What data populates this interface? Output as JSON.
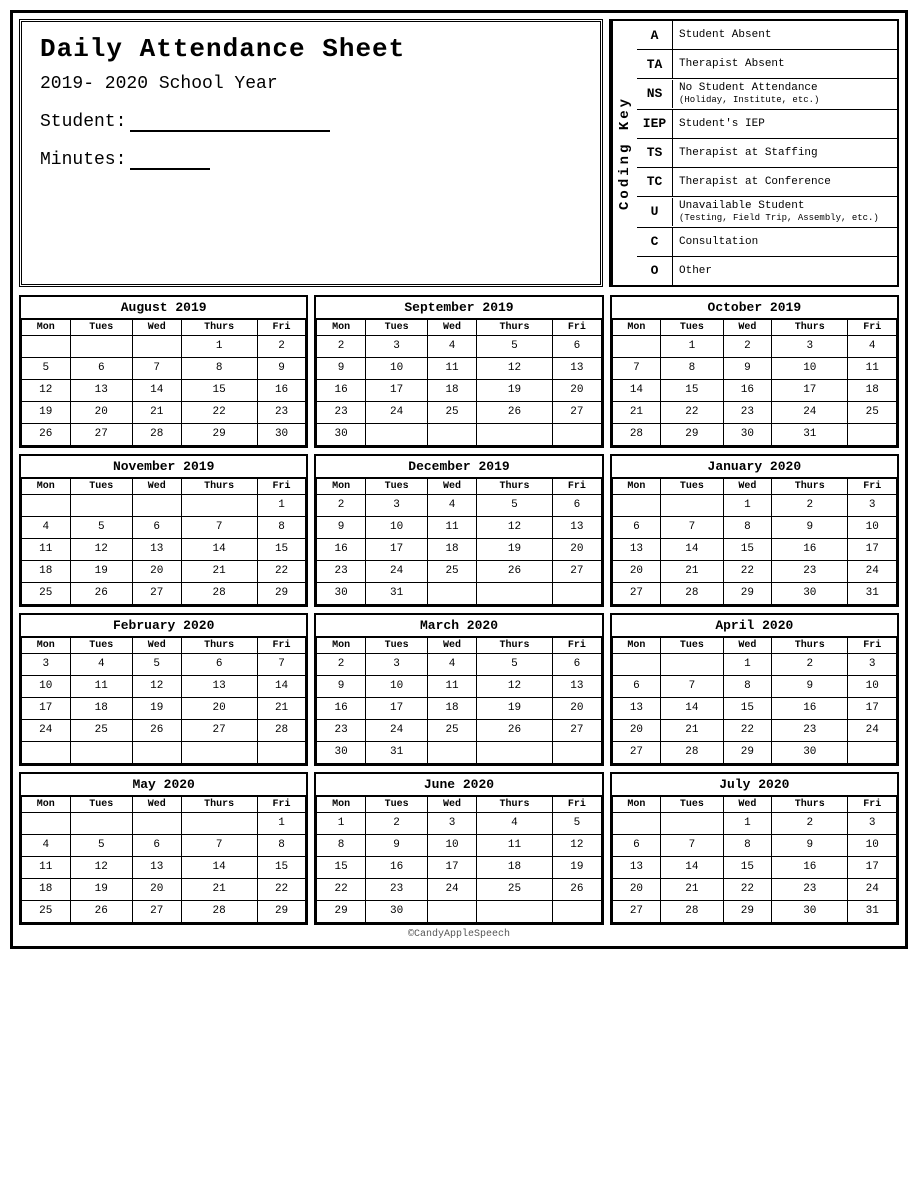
{
  "header": {
    "title": "Daily Attendance Sheet",
    "year": "2019- 2020 School Year",
    "student_label": "Student:",
    "minutes_label": "Minutes:"
  },
  "coding_key": {
    "label": "Coding Key",
    "items": [
      {
        "code": "A",
        "desc": "Student Absent",
        "sub": ""
      },
      {
        "code": "TA",
        "desc": "Therapist Absent",
        "sub": ""
      },
      {
        "code": "NS",
        "desc": "No Student Attendance",
        "sub": "(Holiday, Institute, etc.)"
      },
      {
        "code": "IEP",
        "desc": "Student's IEP",
        "sub": ""
      },
      {
        "code": "TS",
        "desc": "Therapist at Staffing",
        "sub": ""
      },
      {
        "code": "TC",
        "desc": "Therapist at Conference",
        "sub": ""
      },
      {
        "code": "U",
        "desc": "Unavailable Student",
        "sub": "(Testing, Field Trip, Assembly, etc.)"
      },
      {
        "code": "C",
        "desc": "Consultation",
        "sub": ""
      },
      {
        "code": "O",
        "desc": "Other",
        "sub": ""
      }
    ]
  },
  "calendars": [
    {
      "month": "August 2019",
      "days": [
        [
          "",
          "",
          "",
          "1",
          "2"
        ],
        [
          "5",
          "6",
          "7",
          "8",
          "9"
        ],
        [
          "12",
          "13",
          "14",
          "15",
          "16"
        ],
        [
          "19",
          "20",
          "21",
          "22",
          "23"
        ],
        [
          "26",
          "27",
          "28",
          "29",
          "30"
        ]
      ]
    },
    {
      "month": "September 2019",
      "days": [
        [
          "2",
          "3",
          "4",
          "5",
          "6"
        ],
        [
          "9",
          "10",
          "11",
          "12",
          "13"
        ],
        [
          "16",
          "17",
          "18",
          "19",
          "20"
        ],
        [
          "23",
          "24",
          "25",
          "26",
          "27"
        ],
        [
          "30",
          "",
          "",
          "",
          ""
        ]
      ]
    },
    {
      "month": "October 2019",
      "days": [
        [
          "",
          "1",
          "2",
          "3",
          "4"
        ],
        [
          "7",
          "8",
          "9",
          "10",
          "11"
        ],
        [
          "14",
          "15",
          "16",
          "17",
          "18"
        ],
        [
          "21",
          "22",
          "23",
          "24",
          "25"
        ],
        [
          "28",
          "29",
          "30",
          "31",
          ""
        ]
      ]
    },
    {
      "month": "November 2019",
      "days": [
        [
          "",
          "",
          "",
          "",
          "1"
        ],
        [
          "4",
          "5",
          "6",
          "7",
          "8"
        ],
        [
          "11",
          "12",
          "13",
          "14",
          "15"
        ],
        [
          "18",
          "19",
          "20",
          "21",
          "22"
        ],
        [
          "25",
          "26",
          "27",
          "28",
          "29"
        ]
      ]
    },
    {
      "month": "December 2019",
      "days": [
        [
          "2",
          "3",
          "4",
          "5",
          "6"
        ],
        [
          "9",
          "10",
          "11",
          "12",
          "13"
        ],
        [
          "16",
          "17",
          "18",
          "19",
          "20"
        ],
        [
          "23",
          "24",
          "25",
          "26",
          "27"
        ],
        [
          "30",
          "31",
          "",
          "",
          ""
        ]
      ]
    },
    {
      "month": "January 2020",
      "days": [
        [
          "",
          "1",
          "2",
          "3"
        ],
        [
          "6",
          "7",
          "8",
          "9",
          "10"
        ],
        [
          "13",
          "14",
          "15",
          "16",
          "17"
        ],
        [
          "20",
          "21",
          "22",
          "23",
          "24"
        ],
        [
          "27",
          "28",
          "29",
          "30",
          "31"
        ]
      ]
    },
    {
      "month": "February 2020",
      "days": [
        [
          "3",
          "4",
          "5",
          "6",
          "7"
        ],
        [
          "10",
          "11",
          "12",
          "13",
          "14"
        ],
        [
          "17",
          "18",
          "19",
          "20",
          "21"
        ],
        [
          "24",
          "25",
          "26",
          "27",
          "28"
        ],
        [
          "",
          "",
          "",
          "",
          ""
        ]
      ]
    },
    {
      "month": "March 2020",
      "days": [
        [
          "2",
          "3",
          "4",
          "5",
          "6"
        ],
        [
          "9",
          "10",
          "11",
          "12",
          "13"
        ],
        [
          "16",
          "17",
          "18",
          "19",
          "20"
        ],
        [
          "23",
          "24",
          "25",
          "26",
          "27"
        ],
        [
          "30",
          "31",
          "",
          "",
          ""
        ]
      ]
    },
    {
      "month": "April 2020",
      "days": [
        [
          "",
          "1",
          "2",
          "3"
        ],
        [
          "6",
          "7",
          "8",
          "9",
          "10"
        ],
        [
          "13",
          "14",
          "15",
          "16",
          "17"
        ],
        [
          "20",
          "21",
          "22",
          "23",
          "24"
        ],
        [
          "27",
          "28",
          "29",
          "30",
          ""
        ]
      ]
    },
    {
      "month": "May 2020",
      "days": [
        [
          "",
          "",
          "",
          "",
          "1"
        ],
        [
          "4",
          "5",
          "6",
          "7",
          "8"
        ],
        [
          "11",
          "12",
          "13",
          "14",
          "15"
        ],
        [
          "18",
          "19",
          "20",
          "21",
          "22"
        ],
        [
          "25",
          "26",
          "27",
          "28",
          "29"
        ]
      ]
    },
    {
      "month": "June 2020",
      "days": [
        [
          "1",
          "2",
          "3",
          "4",
          "5"
        ],
        [
          "8",
          "9",
          "10",
          "11",
          "12"
        ],
        [
          "15",
          "16",
          "17",
          "18",
          "19"
        ],
        [
          "22",
          "23",
          "24",
          "25",
          "26"
        ],
        [
          "29",
          "30",
          "",
          "",
          ""
        ]
      ]
    },
    {
      "month": "July 2020",
      "days": [
        [
          "",
          "1",
          "2",
          "3"
        ],
        [
          "6",
          "7",
          "8",
          "9",
          "10"
        ],
        [
          "13",
          "14",
          "15",
          "16",
          "17"
        ],
        [
          "20",
          "21",
          "22",
          "23",
          "24"
        ],
        [
          "27",
          "28",
          "29",
          "30",
          "31"
        ]
      ]
    }
  ],
  "col_headers": [
    "Mon",
    "Tues",
    "Wed",
    "Thurs",
    "Fri"
  ],
  "footer": "©CandyAppleSpeech"
}
